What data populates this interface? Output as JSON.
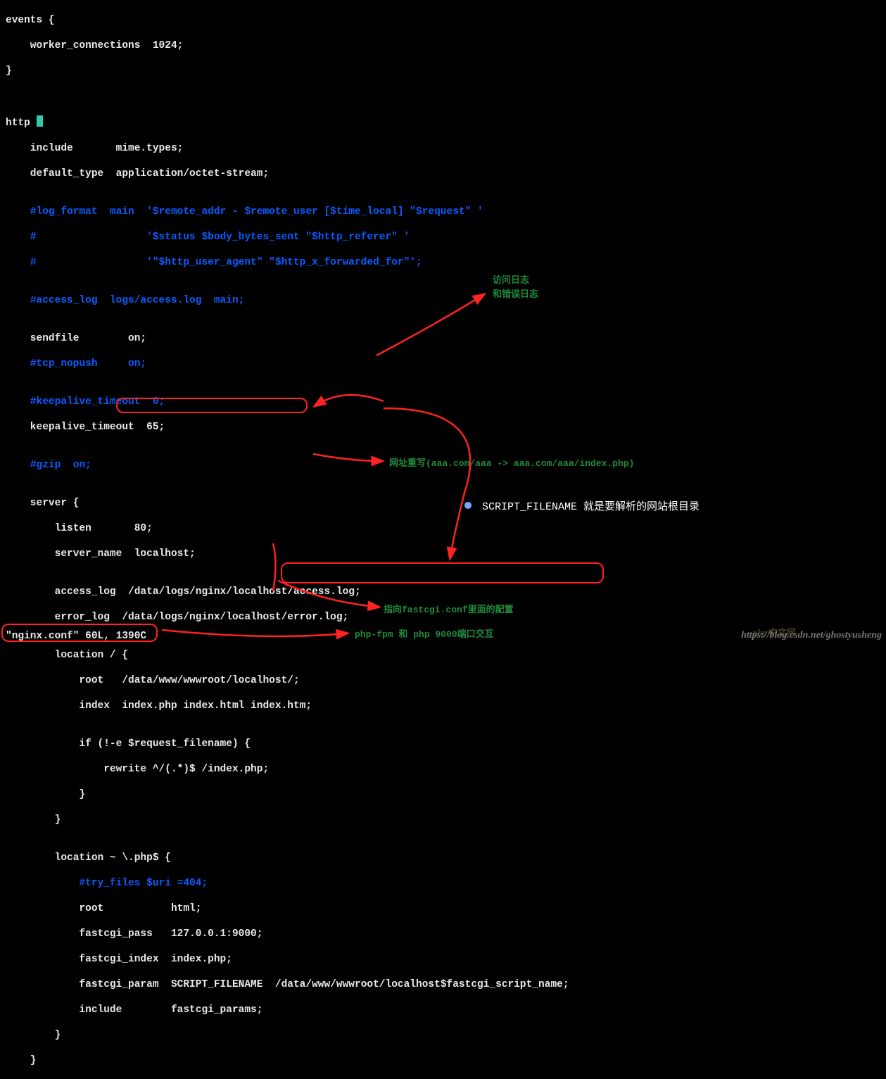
{
  "code": {
    "l1": "events {",
    "l2": "    worker_connections  1024;",
    "l3": "}",
    "l4": "",
    "l5": "",
    "l6": "http ",
    "l7": "    include       mime.types;",
    "l8": "    default_type  application/octet-stream;",
    "l9": "",
    "l10": "    #log_format  main  '$remote_addr - $remote_user [$time_local] \"$request\" '",
    "l11": "    #                  '$status $body_bytes_sent \"$http_referer\" '",
    "l12": "    #                  '\"$http_user_agent\" \"$http_x_forwarded_for\"';",
    "l13": "",
    "l14": "    #access_log  logs/access.log  main;",
    "l15": "",
    "l16": "    sendfile        on;",
    "l17": "    #tcp_nopush     on;",
    "l18": "",
    "l19": "    #keepalive_timeout  0;",
    "l20": "    keepalive_timeout  65;",
    "l21": "",
    "l22": "    #gzip  on;",
    "l23": "",
    "l24": "    server {",
    "l25": "        listen       80;",
    "l26": "        server_name  localhost;",
    "l27": "",
    "l28": "        access_log  /data/logs/nginx/localhost/access.log;",
    "l29": "        error_log  /data/logs/nginx/localhost/error.log;",
    "l30": "",
    "l31": "        location / {",
    "l32a": "            root   ",
    "l32b": "/data/www/wwwroot/localhost/;",
    "l33": "            index  index.php index.html index.htm;",
    "l34": "",
    "l35": "            if (!-e $request_filename) {",
    "l36": "                rewrite ^/(.*)$ /index.php;",
    "l37": "            }",
    "l38": "        }",
    "l39": "",
    "l40": "        location ~ \\.php$ {",
    "l41": "            #try_files $uri =404;",
    "l42": "            root           html;",
    "l43": "            fastcgi_pass   127.0.0.1:9000;",
    "l44": "            fastcgi_index  index.php;",
    "l45a": "            fastcgi_param  SCRIPT_FILENAME  ",
    "l45b": "/data/www/wwwroot/localhost$fastcgi_script_name;",
    "l46": "            include        fastcgi_params;",
    "l47": "        }",
    "l48": "    }"
  },
  "status": "\"nginx.conf\" 60L, 1390C",
  "ann": {
    "a1": "访问日志",
    "a2": "和错误日志",
    "a3": "网址重写(aaa.com/aaa -> aaa.com/aaa/index.php)",
    "a4": "SCRIPT_FILENAME 就是要解析的网站根目录",
    "a5": "指向fastcgi.conf里面的配置",
    "a6": "php-fpm 和 php 9000端口交互"
  },
  "watermark": "https://blog.csdn.net/ghostyusheng",
  "watermark2": "php中文网"
}
